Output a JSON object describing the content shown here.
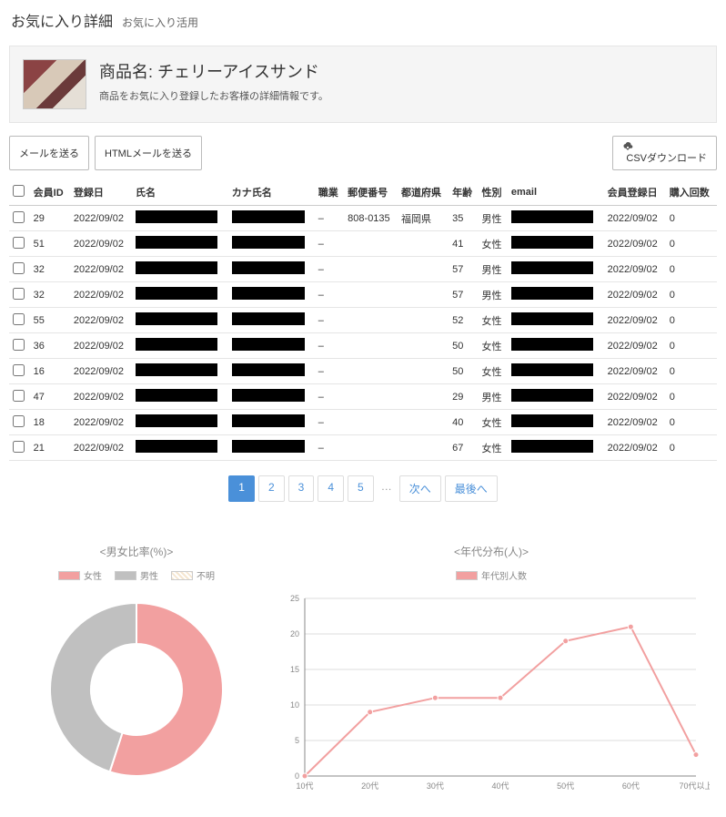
{
  "header": {
    "title": "お気に入り詳細",
    "subtitle": "お気に入り活用"
  },
  "product": {
    "name_prefix": "商品名: ",
    "name": "チェリーアイスサンド",
    "desc": "商品をお気に入り登録したお客様の詳細情報です。"
  },
  "toolbar": {
    "send_mail": "メールを送る",
    "send_html_mail": "HTMLメールを送る",
    "csv_download": "CSVダウンロード"
  },
  "table": {
    "headers": {
      "member_id": "会員ID",
      "reg_date": "登録日",
      "name": "氏名",
      "kana": "カナ氏名",
      "occupation": "職業",
      "postal": "郵便番号",
      "prefecture": "都道府県",
      "age": "年齢",
      "gender": "性別",
      "email": "email",
      "member_reg_date": "会員登録日",
      "purchase_count": "購入回数"
    },
    "rows": [
      {
        "id": "29",
        "reg": "2022/09/02",
        "occ": "–",
        "postal": "808-0135",
        "pref": "福岡県",
        "age": "35",
        "gender": "男性",
        "mreg": "2022/09/02",
        "cnt": "0"
      },
      {
        "id": "51",
        "reg": "2022/09/02",
        "occ": "–",
        "postal": "",
        "pref": "",
        "age": "41",
        "gender": "女性",
        "mreg": "2022/09/02",
        "cnt": "0"
      },
      {
        "id": "32",
        "reg": "2022/09/02",
        "occ": "–",
        "postal": "",
        "pref": "",
        "age": "57",
        "gender": "男性",
        "mreg": "2022/09/02",
        "cnt": "0"
      },
      {
        "id": "32",
        "reg": "2022/09/02",
        "occ": "–",
        "postal": "",
        "pref": "",
        "age": "57",
        "gender": "男性",
        "mreg": "2022/09/02",
        "cnt": "0"
      },
      {
        "id": "55",
        "reg": "2022/09/02",
        "occ": "–",
        "postal": "",
        "pref": "",
        "age": "52",
        "gender": "女性",
        "mreg": "2022/09/02",
        "cnt": "0"
      },
      {
        "id": "36",
        "reg": "2022/09/02",
        "occ": "–",
        "postal": "",
        "pref": "",
        "age": "50",
        "gender": "女性",
        "mreg": "2022/09/02",
        "cnt": "0"
      },
      {
        "id": "16",
        "reg": "2022/09/02",
        "occ": "–",
        "postal": "",
        "pref": "",
        "age": "50",
        "gender": "女性",
        "mreg": "2022/09/02",
        "cnt": "0"
      },
      {
        "id": "47",
        "reg": "2022/09/02",
        "occ": "–",
        "postal": "",
        "pref": "",
        "age": "29",
        "gender": "男性",
        "mreg": "2022/09/02",
        "cnt": "0"
      },
      {
        "id": "18",
        "reg": "2022/09/02",
        "occ": "–",
        "postal": "",
        "pref": "",
        "age": "40",
        "gender": "女性",
        "mreg": "2022/09/02",
        "cnt": "0"
      },
      {
        "id": "21",
        "reg": "2022/09/02",
        "occ": "–",
        "postal": "",
        "pref": "",
        "age": "67",
        "gender": "女性",
        "mreg": "2022/09/02",
        "cnt": "0"
      }
    ]
  },
  "pagination": {
    "pages": [
      "1",
      "2",
      "3",
      "4",
      "5"
    ],
    "next": "次へ",
    "last": "最後へ"
  },
  "charts": {
    "gender": {
      "title": "<男女比率(%)>",
      "legend": {
        "female": "女性",
        "male": "男性",
        "unknown": "不明"
      }
    },
    "age": {
      "title": "<年代分布(人)>",
      "legend": {
        "series": "年代別人数"
      }
    }
  },
  "chart_data": [
    {
      "type": "pie",
      "title": "男女比率(%)",
      "series": [
        {
          "name": "女性",
          "value": 55,
          "color": "#f2a0a0"
        },
        {
          "name": "男性",
          "value": 45,
          "color": "#c0c0c0"
        },
        {
          "name": "不明",
          "value": 0,
          "color": "#f5e6d0"
        }
      ]
    },
    {
      "type": "line",
      "title": "年代分布(人)",
      "xlabel": "",
      "ylabel": "",
      "ylim": [
        0,
        25
      ],
      "categories": [
        "10代",
        "20代",
        "30代",
        "40代",
        "50代",
        "60代",
        "70代以上"
      ],
      "series": [
        {
          "name": "年代別人数",
          "values": [
            0,
            9,
            11,
            11,
            19,
            21,
            3
          ]
        }
      ]
    }
  ]
}
